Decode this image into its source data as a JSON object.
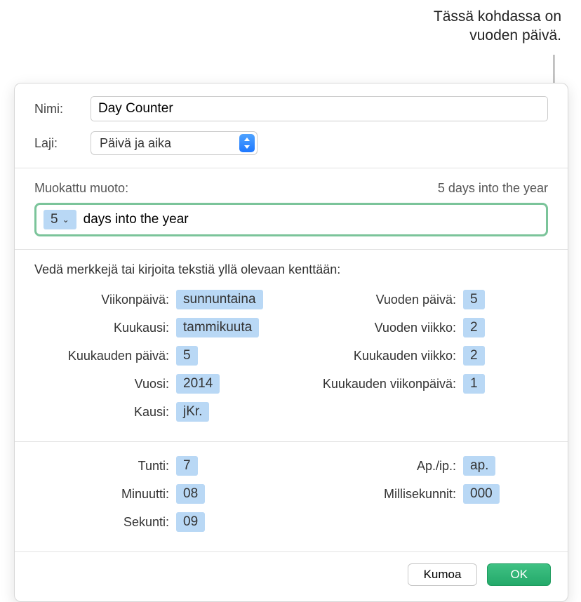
{
  "callout": {
    "line1": "Tässä kohdassa on",
    "line2": "vuoden päivä."
  },
  "labels": {
    "name": "Nimi:",
    "type": "Laji:",
    "custom_format": "Muokattu muoto:",
    "instruction": "Vedä merkkejä tai kirjoita tekstiä yllä olevaan kenttään:"
  },
  "name_value": "Day Counter",
  "type_value": "Päivä ja aika",
  "format_preview": "5 days into the year",
  "format_token_value": "5",
  "format_suffix": "days into the year",
  "tokens_left": [
    {
      "label": "Viikonpäivä:",
      "value": "sunnuntaina"
    },
    {
      "label": "Kuukausi:",
      "value": "tammikuuta"
    },
    {
      "label": "Kuukauden päivä:",
      "value": "5"
    },
    {
      "label": "Vuosi:",
      "value": "2014"
    },
    {
      "label": "Kausi:",
      "value": "jKr."
    }
  ],
  "tokens_right": [
    {
      "label": "Vuoden päivä:",
      "value": "5"
    },
    {
      "label": "Vuoden viikko:",
      "value": "2"
    },
    {
      "label": "Kuukauden viikko:",
      "value": "2"
    },
    {
      "label": "Kuukauden viikonpäivä:",
      "value": "1"
    }
  ],
  "time_left": [
    {
      "label": "Tunti:",
      "value": "7"
    },
    {
      "label": "Minuutti:",
      "value": "08"
    },
    {
      "label": "Sekunti:",
      "value": "09"
    }
  ],
  "time_right": [
    {
      "label": "Ap./ip.:",
      "value": "ap."
    },
    {
      "label": "Millisekunnit:",
      "value": "000"
    }
  ],
  "buttons": {
    "cancel": "Kumoa",
    "ok": "OK"
  }
}
